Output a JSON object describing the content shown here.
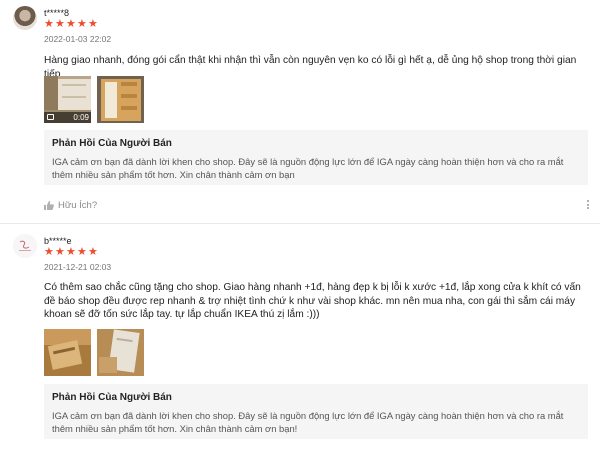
{
  "reviews": [
    {
      "username": "t*****8",
      "rating": 5,
      "stars": [
        "★",
        "★",
        "★",
        "★",
        "★"
      ],
      "datetime": "2022-01-03 22:02",
      "text": "Hàng giao nhanh, đóng gói cẩn thật khi nhận thì vẫn còn nguyên vẹn ko có lỗi gì hết ạ, dễ ủng hộ shop trong thời gian tiếp",
      "video_duration": "0:09",
      "reply_title": "Phản Hồi Của Người Bán",
      "reply_text": "IGA cảm ơn bạn đã dành lời khen cho shop. Đây sẽ là nguồn động lực lớn để IGA ngày càng hoàn thiện hơn và cho ra mắt thêm nhiều sản phẩm tốt hơn. Xin chân thành cảm ơn bạn",
      "helpful_label": "Hữu Ích?"
    },
    {
      "username": "b*****e",
      "rating": 5,
      "stars": [
        "★",
        "★",
        "★",
        "★",
        "★"
      ],
      "datetime": "2021-12-21 02:03",
      "text": "Có thêm sao chắc cũng tặng cho shop. Giao hàng nhanh +1đ, hàng đẹp k bị lỗi k xước +1đ, lắp xong cửa k khít có vấn đề báo shop đều được rep nhanh & trợ nhiệt tình chứ k như vài shop khác. mn nên mua nha, con gái thì sắm cái máy khoan sẽ đỡ tốn sức lắp tay. tự lắp chuẩn IKEA thú zị lắm :)))",
      "reply_title": "Phản Hồi Của Người Bán",
      "reply_text": "IGA cảm ơn bạn đã dành lời khen cho shop. Đây sẽ là nguồn động lực lớn để IGA ngày càng hoàn thiện hơn và cho ra mắt thêm nhiều sản phẩm tốt hơn. Xin chân thành cảm ơn bạn!"
    }
  ],
  "colors": {
    "star": "#ee4d2d",
    "reply_bg": "#f5f5f5",
    "muted": "#757575"
  }
}
